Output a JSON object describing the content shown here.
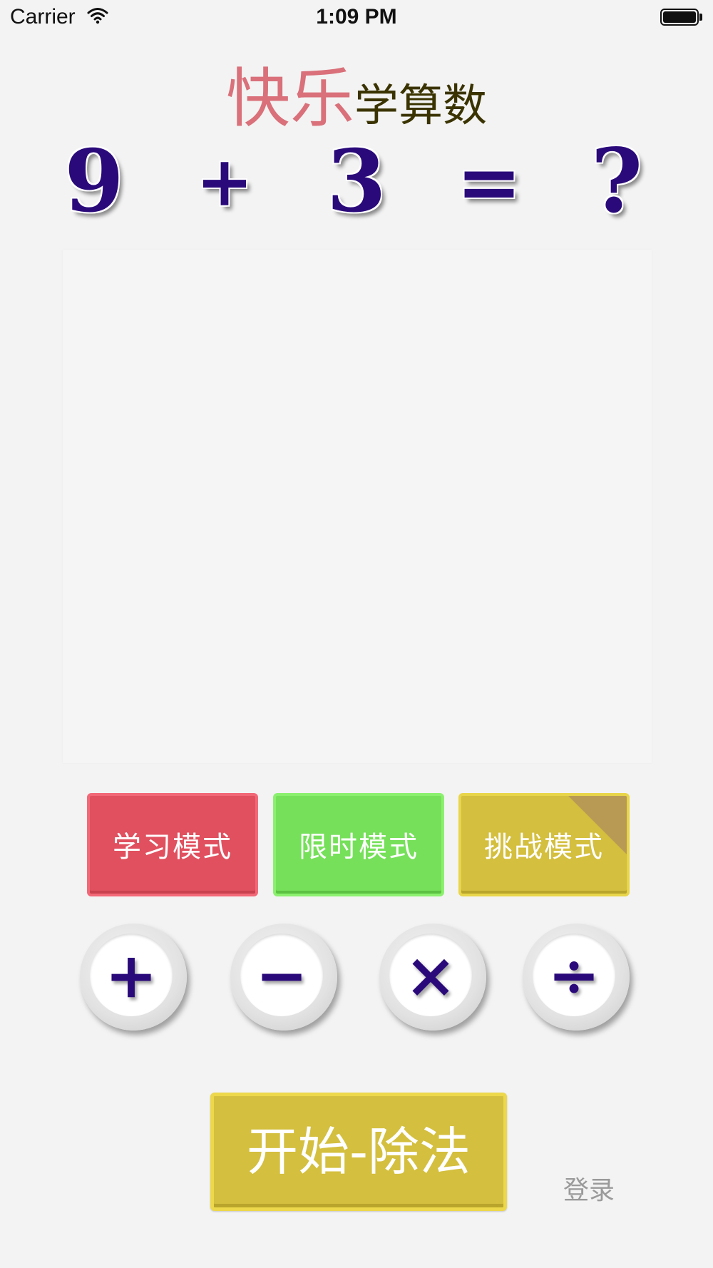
{
  "status_bar": {
    "carrier": "Carrier",
    "time": "1:09 PM",
    "wifi_icon": "wifi-icon",
    "battery_icon": "battery-icon"
  },
  "title": {
    "part1": "快乐",
    "part2": "学算数",
    "part1_color": "#d9707a",
    "part2_color": "#3a3300"
  },
  "equation": {
    "operand1": "9",
    "operator": "+",
    "operand2": "3",
    "equals": "=",
    "result": "?"
  },
  "modes": {
    "learn": "学习模式",
    "timed": "限时模式",
    "challenge": "挑战模式"
  },
  "operations": {
    "add": "+",
    "subtract": "−",
    "multiply": "×",
    "divide": "÷"
  },
  "start_button": "开始-除法",
  "login": "登录",
  "colors": {
    "learn": "#e0505f",
    "timed": "#76e05a",
    "challenge": "#d4bf3e",
    "start": "#d4bf3e",
    "symbol": "#2a0a7a"
  }
}
